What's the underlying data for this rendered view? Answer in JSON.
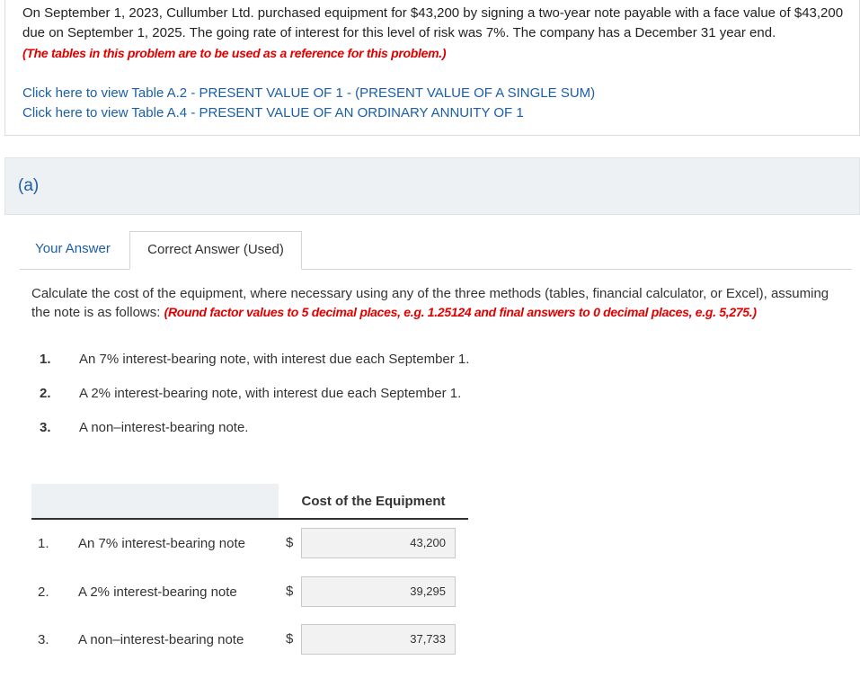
{
  "problem": {
    "text": "On September 1, 2023, Cullumber Ltd. purchased equipment for $43,200 by signing a two-year note payable with a face value of $43,200 due on September 1, 2025. The going rate of interest for this level of risk was 7%. The company has a December 31 year end.",
    "note": "(The tables in this problem are to be used as a reference for this problem.)",
    "links": [
      "Click here to view Table A.2 - PRESENT VALUE OF 1 - (PRESENT VALUE OF A SINGLE SUM)",
      "Click here to view Table A.4 - PRESENT VALUE OF AN ORDINARY ANNUITY OF 1"
    ]
  },
  "part": {
    "label": "(a)"
  },
  "tabs": {
    "your_answer": "Your Answer",
    "correct_answer": "Correct Answer (Used)"
  },
  "instructions": {
    "text": "Calculate the cost of the equipment, where necessary using any of the three methods (tables, financial calculator, or Excel), assuming the note is as follows:",
    "note": "(Round factor values to 5 decimal places, e.g. 1.25124 and final answers to 0 decimal places, e.g. 5,275.)"
  },
  "list": [
    {
      "num": "1.",
      "text": "An 7% interest-bearing note, with interest due each September 1."
    },
    {
      "num": "2.",
      "text": "A 2% interest-bearing note, with interest due each September 1."
    },
    {
      "num": "3.",
      "text": "A non–interest-bearing note."
    }
  ],
  "table": {
    "column_header": "Cost of the Equipment",
    "currency": "$",
    "rows": [
      {
        "num": "1.",
        "label": "An 7% interest-bearing note",
        "value": "43,200"
      },
      {
        "num": "2.",
        "label": "A 2% interest-bearing note",
        "value": "39,295"
      },
      {
        "num": "3.",
        "label": "A non–interest-bearing note",
        "value": "37,733"
      }
    ]
  }
}
